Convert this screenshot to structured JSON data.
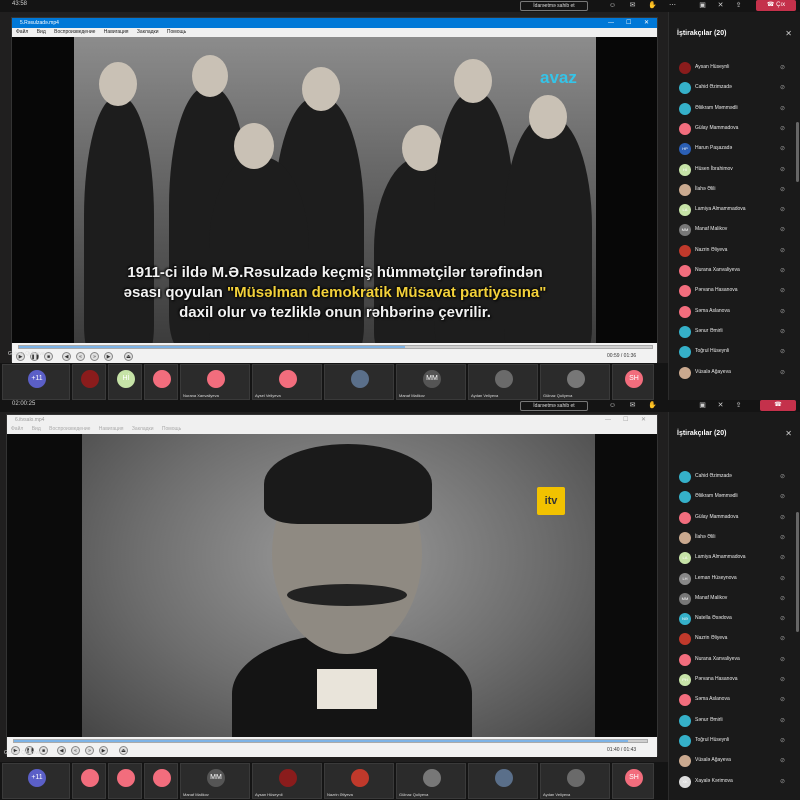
{
  "top": {
    "clock": "43:58",
    "share_label": "İdarəetmə sahib et",
    "leave_label": "Çıx",
    "player": {
      "title": "5.Rəsulzadə.mp4",
      "menu": [
        "Файл",
        "Вид",
        "Воспроизведение",
        "Навигация",
        "Закладки",
        "Помощь"
      ],
      "subtitle_line1": "1911-ci ildə M.Ə.Rəsulzadə keçmiş hümmətçilər tərəfindən",
      "subtitle_line2_pre": "əsası qoyulan ",
      "subtitle_line2_hl": "\"Müsəlman demokratik Müsavat partiyasına\"",
      "subtitle_line3": "daxil olur və tezliklə onun rəhbərinə çevrilir.",
      "logo": "avaz",
      "time": "00:59 / 01:36",
      "progress": 0.61,
      "presenter": "Gülnaz Quliyeva"
    },
    "strip": [
      {
        "label": "+11",
        "color": "#5b5fc7"
      },
      {
        "label": "",
        "color": "#8a1c1c"
      },
      {
        "label": "Hİ",
        "color": "#c6e3a7"
      },
      {
        "label": "",
        "color": "#f26d7d"
      },
      {
        "label": "Nurana Xanvaliyeva",
        "color": "#f26d7d"
      },
      {
        "label": "Aysel Veliyeva",
        "color": "#f26d7d"
      },
      {
        "label": "",
        "color": "#5a6f8a"
      },
      {
        "label": "Manaf Malikov",
        "initials": "MM",
        "color": "#555"
      },
      {
        "label": "Aydan Veliyeva",
        "color": "#6a6a6a"
      },
      {
        "label": "Gülnaz Quliyeva",
        "color": "#777"
      },
      {
        "label": "SH",
        "color": "#f26d7d"
      }
    ],
    "panel": {
      "title": "İştirakçılar (20)",
      "people": [
        {
          "name": "Aysan Hüseynli",
          "initials": "",
          "color": "#8a1c1c"
        },
        {
          "name": "Cahid Əzimzadə",
          "initials": "",
          "color": "#35b0c9"
        },
        {
          "name": "Əliikram Məmmədli",
          "initials": "",
          "color": "#35b0c9"
        },
        {
          "name": "Gülay Mammadova",
          "initials": "",
          "color": "#f26d7d"
        },
        {
          "name": "Harun Paşazadə",
          "initials": "HP",
          "color": "#2b5fb5"
        },
        {
          "name": "Hüsen İbrahimov",
          "initials": "Hİ",
          "color": "#c6e3a7"
        },
        {
          "name": "İlahə Əlili",
          "initials": "",
          "color": "#caa98f"
        },
        {
          "name": "Lamiya Almammadova",
          "initials": "LA",
          "color": "#c6e3a7"
        },
        {
          "name": "Manaf Malikov",
          "initials": "MM",
          "color": "#777"
        },
        {
          "name": "Nazrin Əliyeva",
          "initials": "",
          "color": "#c0392b"
        },
        {
          "name": "Nurana Xanvaliyeva",
          "initials": "",
          "color": "#f26d7d"
        },
        {
          "name": "Pərvana Hasanova",
          "initials": "",
          "color": "#f26d7d"
        },
        {
          "name": "Səma Aslanova",
          "initials": "",
          "color": "#f26d7d"
        },
        {
          "name": "Sənur Əmirli",
          "initials": "",
          "color": "#35b0c9"
        },
        {
          "name": "Toğrul Hüseynli",
          "initials": "",
          "color": "#35b0c9"
        },
        {
          "name": "Vüsalə Ağayeva",
          "initials": "",
          "color": "#caa98f"
        }
      ]
    }
  },
  "bottom": {
    "clock": "02:00:25",
    "share_label": "İdarəetmə sahib et",
    "player": {
      "title": "6.itvsalo.mp4",
      "menu": [
        "Файл",
        "Вид",
        "Воспроизведение",
        "Навигация",
        "Закладки",
        "Помощь"
      ],
      "logo": "itv",
      "time": "01:40 / 01:43",
      "progress": 0.97,
      "presenter": "Gülnaz Quliyeva"
    },
    "strip": [
      {
        "label": "+11",
        "color": "#5b5fc7"
      },
      {
        "label": "",
        "color": "#f26d7d"
      },
      {
        "label": "",
        "color": "#f26d7d"
      },
      {
        "label": "",
        "color": "#f26d7d"
      },
      {
        "label": "Manaf Malikov",
        "initials": "MM",
        "color": "#555"
      },
      {
        "label": "Aysan Hüseynli",
        "color": "#8a1c1c"
      },
      {
        "label": "Nazrin Əliyeva",
        "color": "#c0392b"
      },
      {
        "label": "Gülnaz Quliyeva",
        "color": "#777"
      },
      {
        "label": "",
        "color": "#5a6f8a"
      },
      {
        "label": "Aydan Veliyeva",
        "color": "#6a6a6a"
      },
      {
        "label": "SH",
        "color": "#f26d7d"
      }
    ],
    "panel": {
      "title": "İştirakçılar (20)",
      "people": [
        {
          "name": "Cahid Əzimzadə",
          "initials": "",
          "color": "#35b0c9"
        },
        {
          "name": "Əliikram Məmmədli",
          "initials": "",
          "color": "#35b0c9"
        },
        {
          "name": "Gülay Mammadova",
          "initials": "",
          "color": "#f26d7d"
        },
        {
          "name": "İlahə Əlili",
          "initials": "",
          "color": "#caa98f"
        },
        {
          "name": "Lamiya Almammadova",
          "initials": "LA",
          "color": "#c6e3a7"
        },
        {
          "name": "Leman Hüseynova",
          "initials": "LH",
          "color": "#888"
        },
        {
          "name": "Manaf Malikov",
          "initials": "MM",
          "color": "#777"
        },
        {
          "name": "Natella Əsədova",
          "initials": "NƏ",
          "color": "#35b0c9"
        },
        {
          "name": "Nazrin Əliyeva",
          "initials": "",
          "color": "#c0392b"
        },
        {
          "name": "Nurana Xanvaliyeva",
          "initials": "",
          "color": "#f26d7d"
        },
        {
          "name": "Pərvana Hasanova",
          "initials": "PH",
          "color": "#c6e3a7"
        },
        {
          "name": "Səma Aslanova",
          "initials": "",
          "color": "#f26d7d"
        },
        {
          "name": "Sənur Əmirli",
          "initials": "",
          "color": "#35b0c9"
        },
        {
          "name": "Toğrul Hüseynli",
          "initials": "",
          "color": "#35b0c9"
        },
        {
          "name": "Vüsalə Ağayeva",
          "initials": "",
          "color": "#caa98f"
        },
        {
          "name": "Xayalə Kərimova",
          "initials": "XK",
          "color": "#ddd"
        }
      ]
    }
  }
}
